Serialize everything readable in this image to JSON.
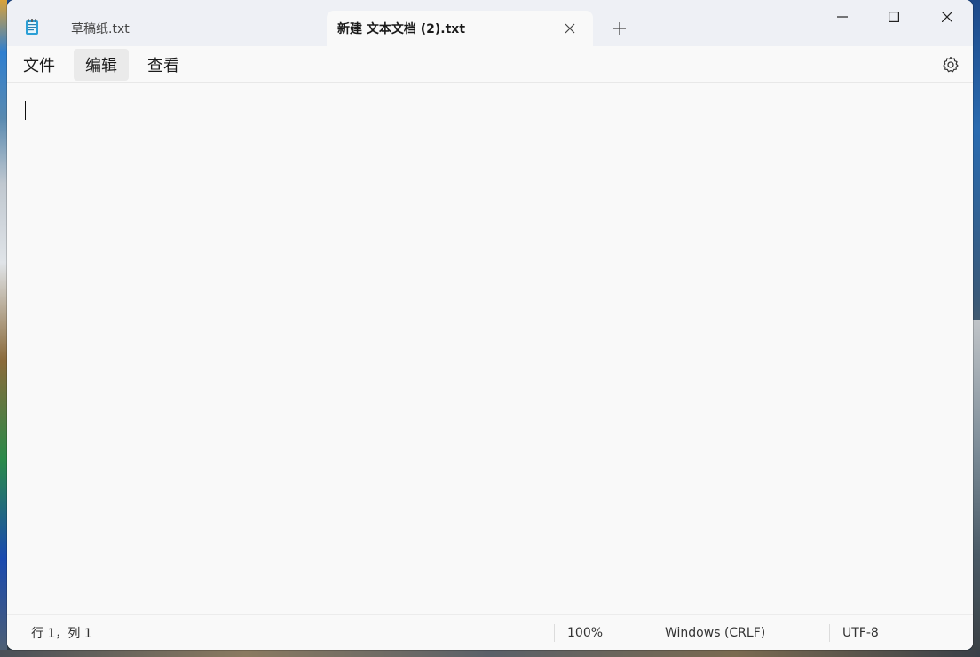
{
  "window": {
    "tabs": [
      {
        "label": "草稿纸.txt",
        "active": false
      },
      {
        "label": "新建 文本文档 (2).txt",
        "active": true
      }
    ],
    "new_tab_icon": "plus-icon",
    "controls": [
      "minimize-icon",
      "maximize-icon",
      "close-icon"
    ]
  },
  "menu": {
    "items": [
      "文件",
      "编辑",
      "查看"
    ],
    "settings_icon": "gear-icon"
  },
  "editor": {
    "content": ""
  },
  "status": {
    "position": "行 1，列 1",
    "zoom": "100%",
    "line_ending": "Windows (CRLF)",
    "encoding": "UTF-8"
  },
  "colors": {
    "tab_bar": "#eef0f5",
    "window_bg": "#f9f9f9",
    "app_icon": "#2a9fd6"
  }
}
